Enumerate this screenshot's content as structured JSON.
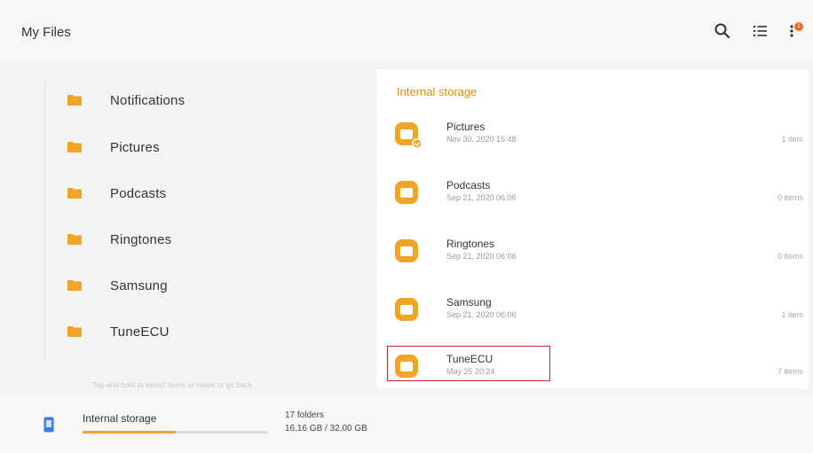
{
  "header": {
    "title": "My Files",
    "icons": [
      "search-icon",
      "list-view-icon",
      "more-options-icon"
    ],
    "badge": "1"
  },
  "tree": {
    "items": [
      {
        "label": "Notifications"
      },
      {
        "label": "Pictures"
      },
      {
        "label": "Podcasts"
      },
      {
        "label": "Ringtones"
      },
      {
        "label": "Samsung"
      },
      {
        "label": "TuneECU"
      }
    ]
  },
  "panel": {
    "title": "Internal storage",
    "rows": [
      {
        "name": "Pictures",
        "date": "Nov 30, 2020 15:48",
        "count": "1 item"
      },
      {
        "name": "Podcasts",
        "date": "Sep 21, 2020 06:06",
        "count": "0 items"
      },
      {
        "name": "Ringtones",
        "date": "Sep 21, 2020 06:06",
        "count": "0 items"
      },
      {
        "name": "Samsung",
        "date": "Sep 21, 2020 06:06",
        "count": "1 item"
      },
      {
        "name": "TuneECU",
        "date": "May 25 20:24",
        "count": "7 items"
      }
    ]
  },
  "hint": "Tap and hold to select items or swipe to go back",
  "storage": {
    "name": "Internal storage",
    "folders": "17 folders",
    "size": "16.16 GB / 32.00 GB",
    "used_fraction": 0.505
  },
  "colors": {
    "accent": "#e08a0c",
    "folder": "#f0a527",
    "selection": "#c62828",
    "storage_bar": "#f2a23a"
  }
}
